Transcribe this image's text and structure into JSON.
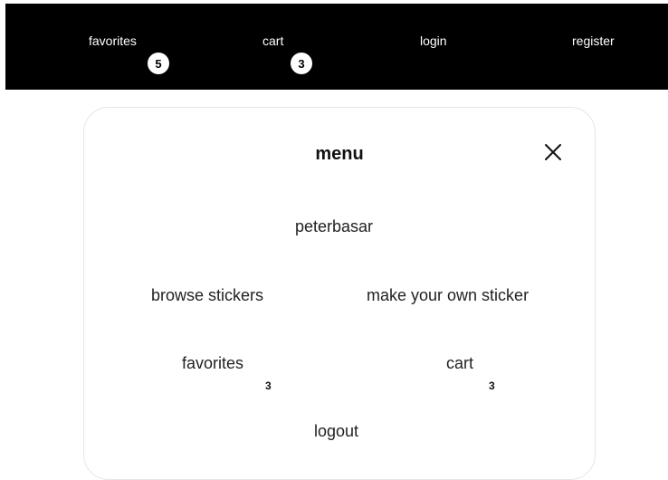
{
  "header": {
    "items": [
      {
        "label": "favorites",
        "badge": "5"
      },
      {
        "label": "cart",
        "badge": "3"
      },
      {
        "label": "login"
      },
      {
        "label": "register"
      }
    ],
    "background": "#000000",
    "text_color": "#ffffff"
  },
  "menu": {
    "title": "menu",
    "close_icon": "close-icon",
    "username": "peterbasar",
    "browse_label": "browse stickers",
    "make_label": "make your own sticker",
    "favorites_label": "favorites",
    "favorites_count": "3",
    "cart_label": "cart",
    "cart_count": "3",
    "logout_label": "logout"
  }
}
